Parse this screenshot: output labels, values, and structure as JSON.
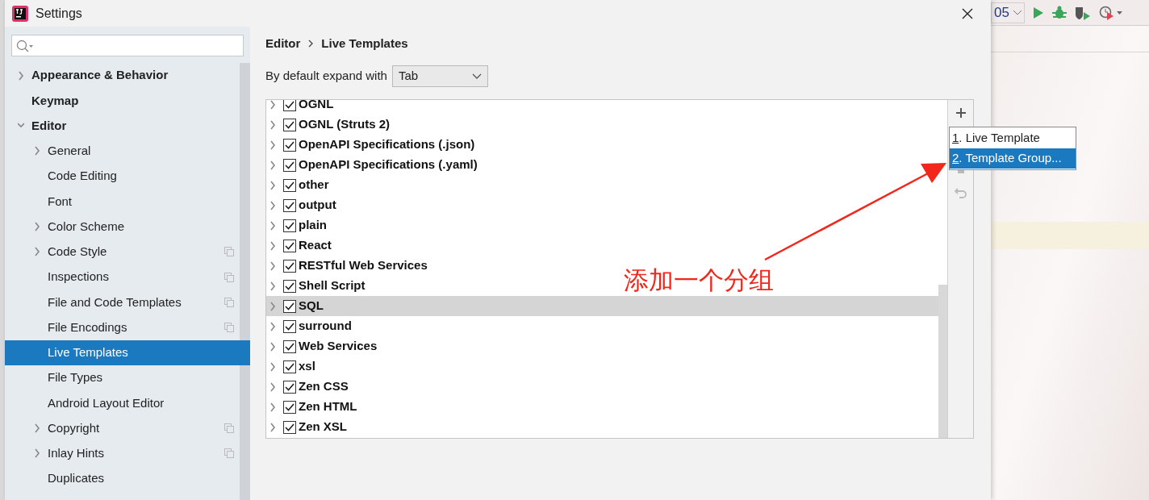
{
  "window": {
    "title": "Settings"
  },
  "ide_toolbar": {
    "config_text": "05"
  },
  "sidebar": {
    "items": [
      {
        "label": "Appearance & Behavior",
        "expanded": false,
        "has_children": true,
        "selected": false
      },
      {
        "label": "Keymap",
        "has_children": false,
        "selected": false
      },
      {
        "label": "Editor",
        "expanded": true,
        "has_children": true,
        "selected": false,
        "children": [
          {
            "label": "General",
            "has_children": true,
            "expanded": false,
            "selected": false
          },
          {
            "label": "Code Editing",
            "selected": false
          },
          {
            "label": "Font",
            "selected": false
          },
          {
            "label": "Color Scheme",
            "has_children": true,
            "expanded": false,
            "selected": false
          },
          {
            "label": "Code Style",
            "has_children": true,
            "expanded": false,
            "project_icon": true,
            "selected": false
          },
          {
            "label": "Inspections",
            "project_icon": true,
            "selected": false
          },
          {
            "label": "File and Code Templates",
            "project_icon": true,
            "selected": false
          },
          {
            "label": "File Encodings",
            "project_icon": true,
            "selected": false
          },
          {
            "label": "Live Templates",
            "selected": true
          },
          {
            "label": "File Types",
            "selected": false
          },
          {
            "label": "Android Layout Editor",
            "selected": false
          },
          {
            "label": "Copyright",
            "has_children": true,
            "expanded": false,
            "project_icon": true,
            "selected": false
          },
          {
            "label": "Inlay Hints",
            "has_children": true,
            "expanded": false,
            "project_icon": true,
            "selected": false
          },
          {
            "label": "Duplicates",
            "selected": false
          }
        ]
      }
    ]
  },
  "breadcrumb": [
    "Editor",
    "Live Templates"
  ],
  "expand_with": {
    "label": "By default expand with",
    "value": "Tab"
  },
  "groups": [
    {
      "label": "OGNL",
      "checked": true,
      "selected": false
    },
    {
      "label": "OGNL (Struts 2)",
      "checked": true,
      "selected": false
    },
    {
      "label": "OpenAPI Specifications (.json)",
      "checked": true,
      "selected": false
    },
    {
      "label": "OpenAPI Specifications (.yaml)",
      "checked": true,
      "selected": false
    },
    {
      "label": "other",
      "checked": true,
      "selected": false
    },
    {
      "label": "output",
      "checked": true,
      "selected": false
    },
    {
      "label": "plain",
      "checked": true,
      "selected": false
    },
    {
      "label": "React",
      "checked": true,
      "selected": false
    },
    {
      "label": "RESTful Web Services",
      "checked": true,
      "selected": false
    },
    {
      "label": "Shell Script",
      "checked": true,
      "selected": false
    },
    {
      "label": "SQL",
      "checked": true,
      "selected": true
    },
    {
      "label": "surround",
      "checked": true,
      "selected": false
    },
    {
      "label": "Web Services",
      "checked": true,
      "selected": false
    },
    {
      "label": "xsl",
      "checked": true,
      "selected": false
    },
    {
      "label": "Zen CSS",
      "checked": true,
      "selected": false
    },
    {
      "label": "Zen HTML",
      "checked": true,
      "selected": false
    },
    {
      "label": "Zen XSL",
      "checked": true,
      "selected": false
    }
  ],
  "add_menu": [
    {
      "mnemonic": "1",
      "rest": ". Live Template",
      "selected": false
    },
    {
      "mnemonic": "2",
      "rest": ". Template Group...",
      "selected": true
    }
  ],
  "annotation": {
    "text": "添加一个分组"
  }
}
